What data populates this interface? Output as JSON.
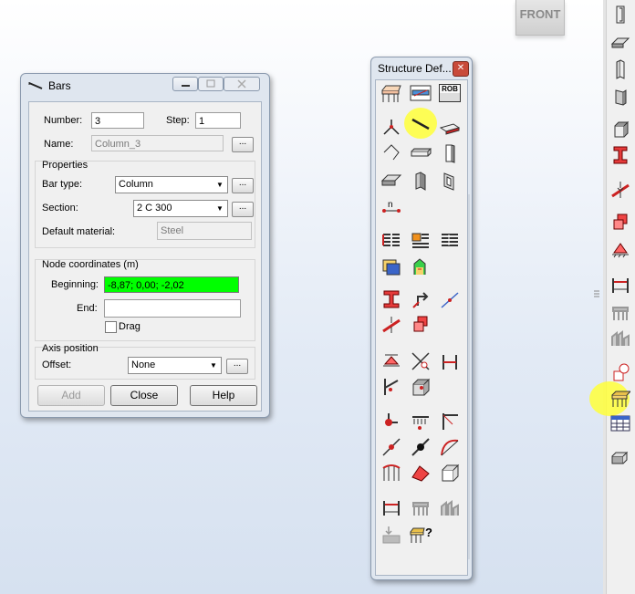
{
  "viewport": {
    "front_label": "FRONT"
  },
  "bars_dialog": {
    "title": "Bars",
    "number_label": "Number:",
    "number_value": "3",
    "step_label": "Step:",
    "step_value": "1",
    "name_label": "Name:",
    "name_value": "Column_3",
    "properties_group": "Properties",
    "bar_type_label": "Bar type:",
    "bar_type_value": "Column",
    "section_label": "Section:",
    "section_value": "2 C 300",
    "default_material_label": "Default material:",
    "default_material_value": "Steel",
    "node_group": "Node coordinates (m)",
    "beginning_label": "Beginning:",
    "beginning_value": "-8,87; 0,00; -2,02",
    "end_label": "End:",
    "end_value": "",
    "drag_label": "Drag",
    "drag_checked": false,
    "axis_group": "Axis position",
    "offset_label": "Offset:",
    "offset_value": "None",
    "browse_label": "...",
    "add_label": "Add",
    "close_label": "Close",
    "help_label": "Help",
    "colors": {
      "beginning_bg": "#00ff00"
    }
  },
  "structure_dialog": {
    "title": "Structure Def...",
    "rob_label": "ROB",
    "help_mark": "?",
    "highlight_color": "#ffff33"
  }
}
